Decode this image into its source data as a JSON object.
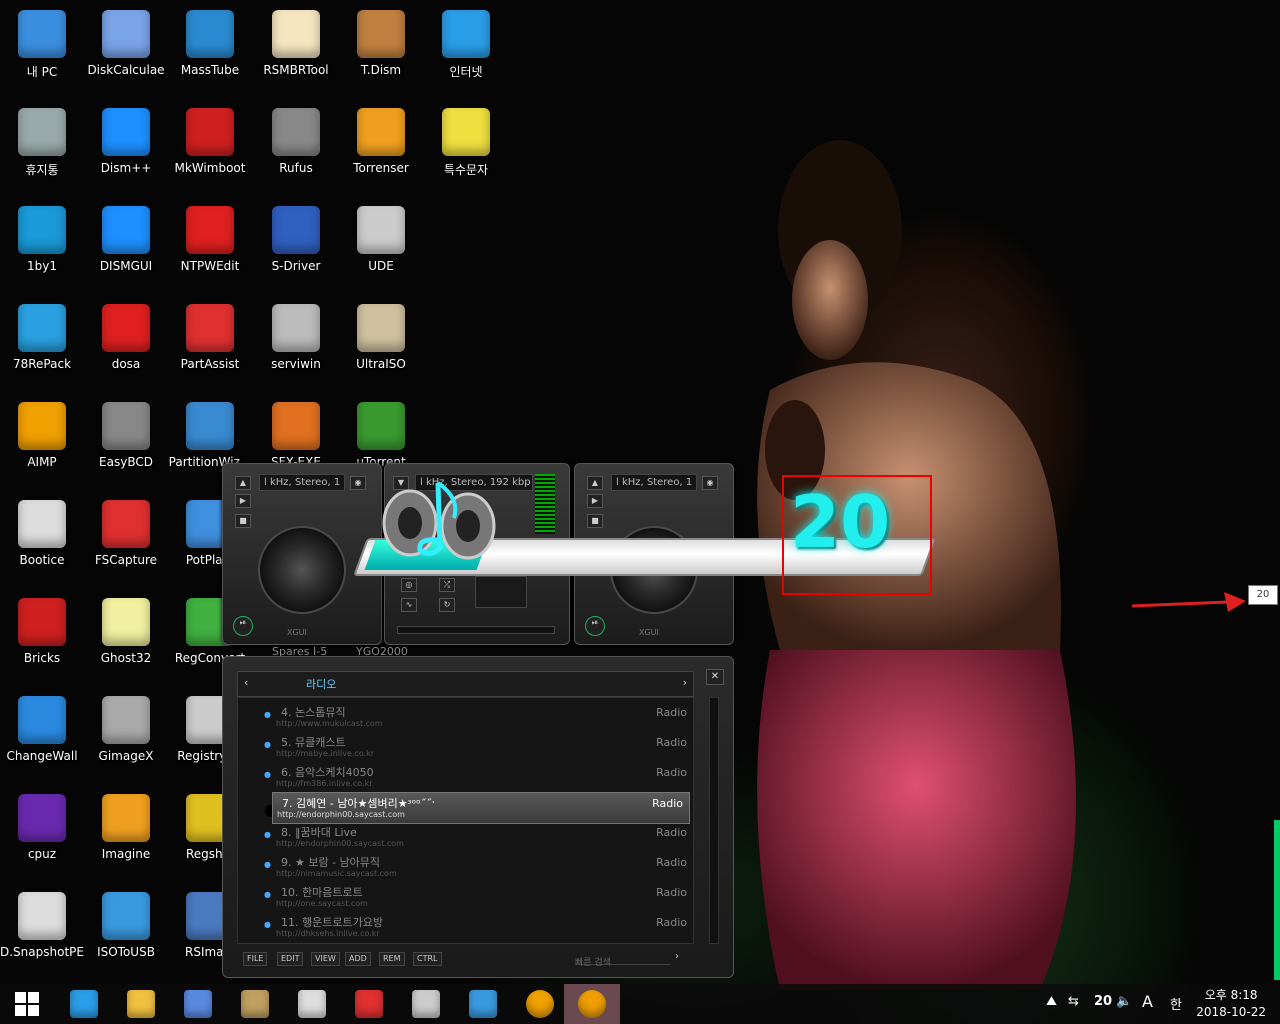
{
  "desktop_icons": [
    {
      "label": "내 PC",
      "icon": "computer-icon",
      "color": "#3b8fe0"
    },
    {
      "label": "DiskCalculae",
      "icon": "pie-disk-icon",
      "color": "#7aa4e8"
    },
    {
      "label": "MassTube",
      "icon": "globe-download-icon",
      "color": "#2a8ad0"
    },
    {
      "label": "RSMBRTool",
      "icon": "rs-logo-icon",
      "color": "#f5e6c0"
    },
    {
      "label": "T.Dism",
      "icon": "box-disc-icon",
      "color": "#c08040"
    },
    {
      "label": "인터넷",
      "icon": "ie-icon",
      "color": "#2a9ee8"
    },
    {
      "label": "휴지통",
      "icon": "recycle-bin-icon",
      "color": "#9aa"
    },
    {
      "label": "Dism++",
      "icon": "gears-icon",
      "color": "#1e90ff"
    },
    {
      "label": "MkWimboot",
      "icon": "ladybug-icon",
      "color": "#d02020"
    },
    {
      "label": "Rufus",
      "icon": "usb-drive-icon",
      "color": "#888"
    },
    {
      "label": "Torrenser",
      "icon": "smiley-icon",
      "color": "#f0a020"
    },
    {
      "label": "특수문자",
      "icon": "sticky-note-icon",
      "color": "#f0e040"
    },
    {
      "label": "1by1",
      "icon": "1by1-icon",
      "color": "#1a9ad6"
    },
    {
      "label": "DISMGUI",
      "icon": "windows-logo-icon",
      "color": "#1e90ff"
    },
    {
      "label": "NTPWEdit",
      "icon": "nt-key-icon",
      "color": "#e02020"
    },
    {
      "label": "S-Driver",
      "icon": "graphics-card-icon",
      "color": "#3060c0"
    },
    {
      "label": "UDE",
      "icon": "usb-box-icon",
      "color": "#ccc"
    },
    {
      "label": "78RePack",
      "icon": "triangle-logo-icon",
      "color": "#2aa0e0"
    },
    {
      "label": "dosa",
      "icon": "hangul-icon",
      "color": "#e02020"
    },
    {
      "label": "PartAssist",
      "icon": "partition-disk-icon",
      "color": "#e03030"
    },
    {
      "label": "serviwin",
      "icon": "serviwin-icon",
      "color": "#bbb"
    },
    {
      "label": "UltraISO",
      "icon": "cd-icon",
      "color": "#d0c0a0"
    },
    {
      "label": "AIMP",
      "icon": "aimp-icon",
      "color": "#f0a000"
    },
    {
      "label": "EasyBCD",
      "icon": "pc-tower-icon",
      "color": "#888"
    },
    {
      "label": "PartitionWiz...",
      "icon": "wizard-wand-icon",
      "color": "#3a8ad0"
    },
    {
      "label": "SFX-EXE",
      "icon": "box-arrow-icon",
      "color": "#e07020"
    },
    {
      "label": "uTorrent",
      "icon": "utorrent-icon",
      "color": "#3a9a30"
    },
    {
      "label": "Bootice",
      "icon": "bootice-icon",
      "color": "#ddd"
    },
    {
      "label": "FSCapture",
      "icon": "fscapture-icon",
      "color": "#e03030"
    },
    {
      "label": "PotPla...",
      "icon": "potplayer-icon",
      "color": "#4090e0"
    },
    {
      "label": "Bricks",
      "icon": "flash-icon",
      "color": "#d02020"
    },
    {
      "label": "Ghost32",
      "icon": "ghost-icon",
      "color": "#f0f0a0"
    },
    {
      "label": "RegConvert",
      "icon": "green-cubes-icon",
      "color": "#40b040"
    },
    {
      "label": "ChangeWall",
      "icon": "monitor-paint-icon",
      "color": "#2a8ae0"
    },
    {
      "label": "GimageX",
      "icon": "scanner-icon",
      "color": "#aaa"
    },
    {
      "label": "RegistryF...",
      "icon": "magnifier-icon",
      "color": "#ccc"
    },
    {
      "label": "cpuz",
      "icon": "cpu-chip-icon",
      "color": "#6a2ab0"
    },
    {
      "label": "Imagine",
      "icon": "sunflower-icon",
      "color": "#f0a020"
    },
    {
      "label": "Regsh...",
      "icon": "registry-cubes-icon",
      "color": "#e0c020"
    },
    {
      "label": "D.SnapshotPE",
      "icon": "drive-clock-icon",
      "color": "#ddd"
    },
    {
      "label": "ISOToUSB",
      "icon": "usb-windows-icon",
      "color": "#3a9ae0"
    },
    {
      "label": "RSIma...",
      "icon": "laptop-icon",
      "color": "#4a7ac0"
    }
  ],
  "player": {
    "deck_left_lcd": "l kHz, Stereo, 1",
    "deck_center_lcd": "l kHz, Stereo, 192 kbp",
    "deck_right_lcd": "l kHz, Stereo, 1",
    "deck_brand": "XGUI",
    "under_label_1": "Spares I-5",
    "under_label_2": "YGO2000"
  },
  "volume_osd": {
    "value": "20",
    "level_percent": 20,
    "tooltip": "20"
  },
  "playlist": {
    "tab_label": "라디오",
    "rows": [
      {
        "title": "4. 논스톱뮤직",
        "url": "http://www.mukulcast.com",
        "genre": "Radio",
        "selected": false
      },
      {
        "title": "5. 뮤클캐스트",
        "url": "http://mabye.inlive.co.kr",
        "genre": "Radio",
        "selected": false
      },
      {
        "title": "6. 음악스케치4050",
        "url": "http://fm386.inlive.co.kr",
        "genre": "Radio",
        "selected": false
      },
      {
        "title": "7. 김혜연 - 남아★셈벼리★ᶟᵒᵒ˝˝ˑ",
        "url": "http://endorphin00.saycast.com",
        "genre": "Radio",
        "selected": true
      },
      {
        "title": "8. ‖꿈바대  Live",
        "url": "http://endorphin00.saycast.com",
        "genre": "Radio",
        "selected": false
      },
      {
        "title": "9. ★ 보람 - 남아뮤직",
        "url": "http://nimamusic.saycast.com",
        "genre": "Radio",
        "selected": false
      },
      {
        "title": "10. 한마음트로트",
        "url": "http://one.saycast.com",
        "genre": "Radio",
        "selected": false
      },
      {
        "title": "11. 행운트로트가요방",
        "url": "http://dhksehs.inlive.co.kr",
        "genre": "Radio",
        "selected": false
      }
    ],
    "buttons": [
      "FILE",
      "EDIT",
      "VIEW",
      "ADD",
      "REM",
      "CTRL"
    ],
    "search_placeholder": "빠른 검색"
  },
  "taskbar": {
    "apps": [
      "start-icon",
      "ie-icon",
      "file-explorer-icon",
      "notepad-icon",
      "rsmbr-icon",
      "bootice-icon",
      "partassist-icon",
      "ude-icon",
      "changewall-icon",
      "aimp-icon",
      "aimp-active-icon"
    ],
    "tray_volume_num": "20",
    "tray_ime": "A",
    "tray_lang": "한",
    "time": "오후 8:18",
    "date": "2018-10-22"
  }
}
